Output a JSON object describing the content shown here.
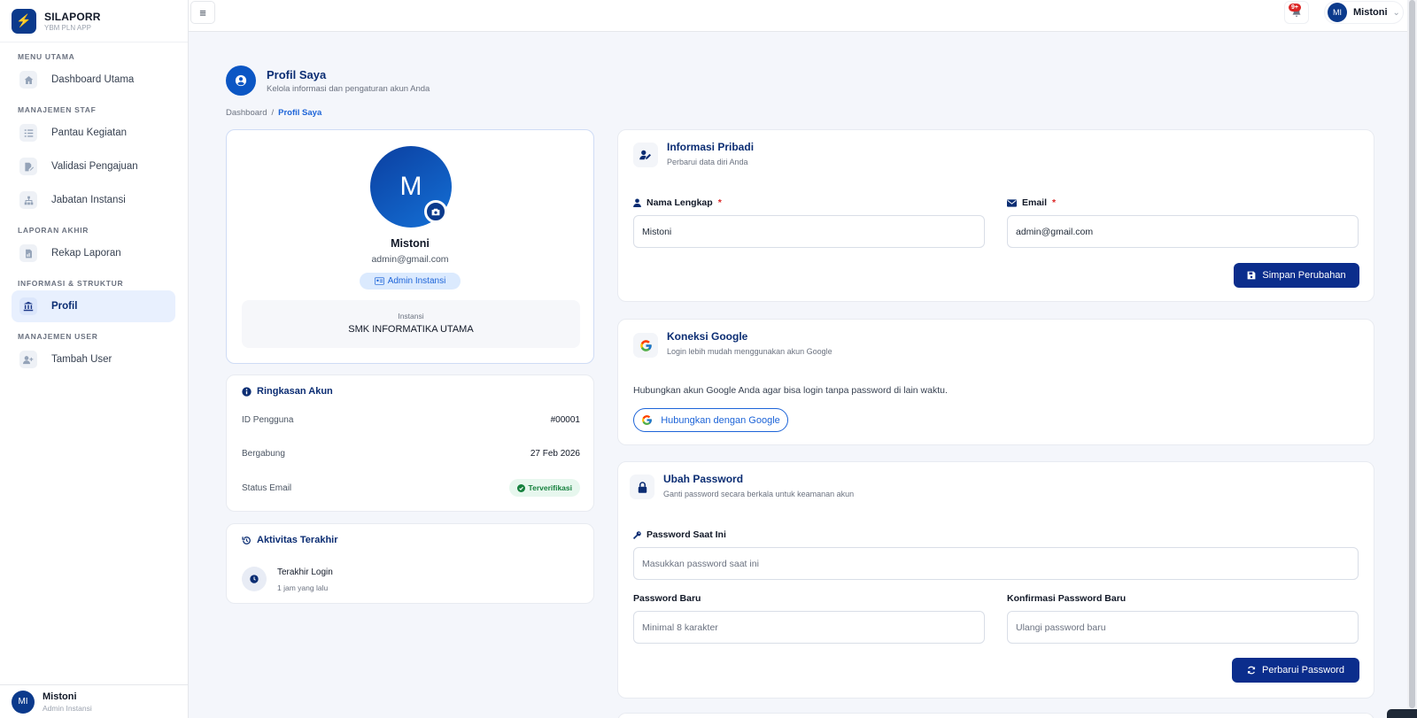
{
  "brand": {
    "name": "SILAPORR",
    "subtitle": "YBM PLN APP"
  },
  "sidebar": {
    "sections": [
      {
        "title": "MENU UTAMA",
        "items": [
          {
            "label": "Dashboard Utama",
            "icon": "home-icon"
          }
        ]
      },
      {
        "title": "MANAJEMEN STAF",
        "items": [
          {
            "label": "Pantau Kegiatan",
            "icon": "list-check-icon"
          },
          {
            "label": "Validasi Pengajuan",
            "icon": "file-signature-icon"
          },
          {
            "label": "Jabatan Instansi",
            "icon": "sitemap-icon"
          }
        ]
      },
      {
        "title": "LAPORAN AKHIR",
        "items": [
          {
            "label": "Rekap Laporan",
            "icon": "file-chart-icon"
          }
        ]
      },
      {
        "title": "INFORMASI & STRUKTUR",
        "items": [
          {
            "label": "Profil",
            "icon": "institution-icon",
            "active": true
          }
        ]
      },
      {
        "title": "MANAJEMEN USER",
        "items": [
          {
            "label": "Tambah User",
            "icon": "user-plus-icon"
          }
        ]
      }
    ],
    "user": {
      "initials": "MI",
      "name": "Mistoni",
      "role": "Admin Instansi"
    }
  },
  "topbar": {
    "notif_badge": "9+",
    "user_initials": "MI",
    "user_name": "Mistoni"
  },
  "page": {
    "title": "Profil Saya",
    "subtitle": "Kelola informasi dan pengaturan akun Anda",
    "breadcrumb": {
      "home": "Dashboard",
      "separator": "/",
      "current": "Profil Saya"
    }
  },
  "profile": {
    "avatar_letter": "M",
    "name": "Mistoni",
    "email": "admin@gmail.com",
    "role": "Admin Instansi",
    "instansi_label": "Instansi",
    "instansi_value": "SMK INFORMATIKA UTAMA"
  },
  "summary": {
    "title": "Ringkasan Akun",
    "rows": [
      {
        "label": "ID Pengguna",
        "value": "#00001"
      },
      {
        "label": "Bergabung",
        "value": "27 Feb 2026"
      },
      {
        "label": "Status Email",
        "value": "Terverifikasi"
      }
    ]
  },
  "activity": {
    "title": "Aktivitas Terakhir",
    "item_title": "Terakhir Login",
    "item_time": "1 jam yang lalu"
  },
  "personal": {
    "title": "Informasi Pribadi",
    "subtitle": "Perbarui data diri Anda",
    "name_label": "Nama Lengkap",
    "name_value": "Mistoni",
    "email_label": "Email",
    "email_value": "admin@gmail.com",
    "required_mark": "*",
    "save_label": "Simpan Perubahan"
  },
  "google": {
    "title": "Koneksi Google",
    "subtitle": "Login lebih mudah menggunakan akun Google",
    "description": "Hubungkan akun Google Anda agar bisa login tanpa password di lain waktu.",
    "button_label": "Hubungkan dengan Google"
  },
  "password": {
    "title": "Ubah Password",
    "subtitle": "Ganti password secara berkala untuk keamanan akun",
    "current_label": "Password Saat Ini",
    "current_placeholder": "Masukkan password saat ini",
    "new_label": "Password Baru",
    "new_placeholder": "Minimal 8 karakter",
    "confirm_label": "Konfirmasi Password Baru",
    "confirm_placeholder": "Ulangi password baru",
    "submit_label": "Perbarui Password"
  },
  "colors": {
    "primary": "#0b2d8c",
    "accent": "#1d64d8",
    "active_bg": "#e8f0fe",
    "danger": "#dc2626",
    "success": "#15803d"
  }
}
